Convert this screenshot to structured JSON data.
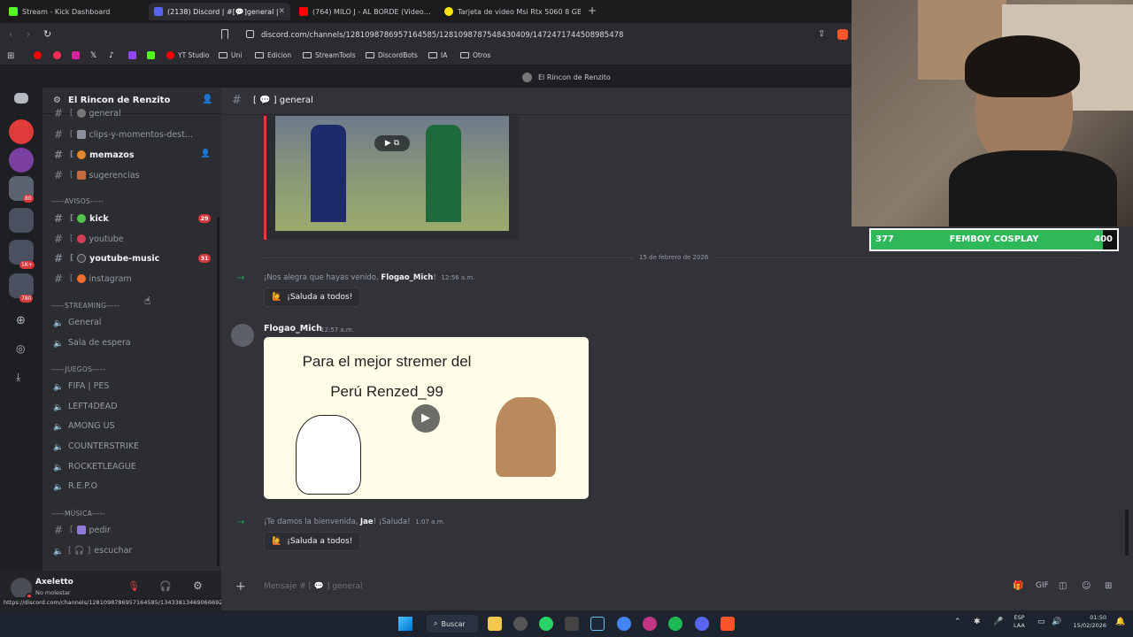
{
  "browser": {
    "tabs": [
      {
        "title": "Stream - Kick Dashboard",
        "color": "#53fc18",
        "active": false
      },
      {
        "title": "(2138) Discord | #[💬]general |",
        "color": "#5865f2",
        "active": true
      },
      {
        "title": "(764) MILO J - AL BORDE (Video…",
        "color": "#ff0000",
        "active": false
      },
      {
        "title": "Tarjeta de video Msi Rtx 5060 8 GB G…",
        "color": "#ffe600",
        "active": false
      }
    ],
    "url": "discord.com/channels/1281098786957164585/1281098787548430409/1472471744508985478",
    "bookmarks": [
      {
        "label": "YT Studio",
        "type": "app"
      },
      {
        "label": "Uni",
        "type": "folder"
      },
      {
        "label": "Edicion",
        "type": "folder"
      },
      {
        "label": "StreamTools",
        "type": "folder"
      },
      {
        "label": "DiscordBots",
        "type": "folder"
      },
      {
        "label": "IA",
        "type": "folder"
      },
      {
        "label": "Otros",
        "type": "folder"
      }
    ],
    "status_url": "https://discord.com/channels/1281098786957164585/1343381346906669218"
  },
  "discord": {
    "window_title": "El Rincon de Renzito",
    "server_name": "El Rincon de Renzito",
    "current_channel": "[ 💬 ]  general",
    "guild_badges": [
      "80",
      "1K+",
      "780"
    ],
    "text_channels_top": [
      {
        "name": "general",
        "bright": false
      },
      {
        "name": "clips-y-momentos-dest...",
        "bright": false
      },
      {
        "name": "memazos",
        "bright": true
      },
      {
        "name": "sugerencias",
        "bright": false
      }
    ],
    "avisos": {
      "category": "-----AVISOS-----",
      "channels": [
        {
          "name": "kick",
          "bright": true,
          "badge": "29"
        },
        {
          "name": "youtube",
          "bright": false,
          "badge": ""
        },
        {
          "name": "youtube-music",
          "bright": true,
          "badge": "31"
        },
        {
          "name": "instagram",
          "bright": false,
          "badge": ""
        }
      ]
    },
    "streaming": {
      "category": "-----STREAMING-----",
      "channels": [
        "General",
        "Sala de espera"
      ]
    },
    "juegos": {
      "category": "-----JUEGOS-----",
      "channels": [
        "FIFA | PES",
        "LEFT4DEAD",
        "AMONG US",
        "COUNTERSTRIKE",
        "ROCKETLEAGUE",
        "R.E.P.O"
      ]
    },
    "musica": {
      "category": "-----MÚSICA-----",
      "channels": [
        "pedir",
        "escuchar"
      ]
    },
    "user": {
      "name": "Axeletto",
      "status": "No molestar"
    },
    "messages": {
      "date_divider": "15 de febrero de 2026",
      "join1": {
        "text": "¡Nos alegra que hayas venido,",
        "user": "Flogao_Mich",
        "suffix": "!",
        "time": "12:56 a.m.",
        "button": "¡Saluda a todos!"
      },
      "post": {
        "author": "Flogao_Mich",
        "time": "12:57 a.m.",
        "image_line1": "Para el mejor stremer del",
        "image_line2": "Perú Renzed_99"
      },
      "join2": {
        "text": "¡Te damos la bienvenida,",
        "user": "Jae",
        "suffix": "! ¡Saluda!",
        "time": "1:07 a.m.",
        "button": "¡Saluda a todos!"
      }
    },
    "composer_placeholder": "Mensaje #  [ 💬 ]  general"
  },
  "overlay": {
    "left_value": "377",
    "label": "FEMBOY COSPLAY",
    "right_value": "400",
    "progress": 0.9425
  },
  "taskbar": {
    "search": "Buscar",
    "lang": "ESP",
    "region": "LAA",
    "time": "01:50",
    "date": "15/02/2026"
  }
}
